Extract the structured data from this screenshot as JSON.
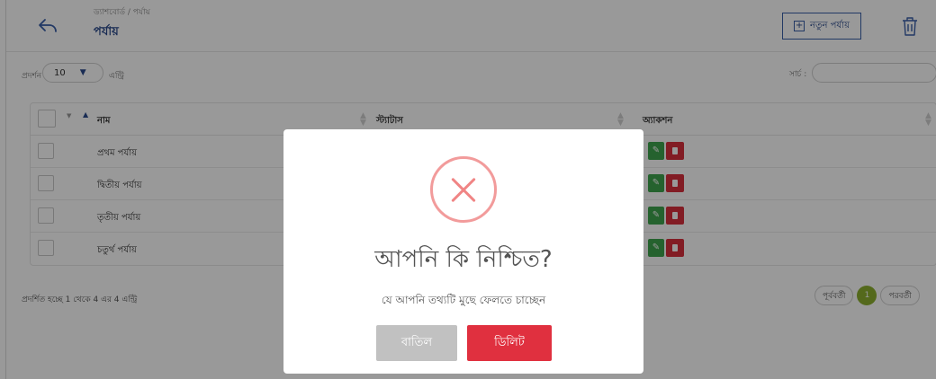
{
  "header": {
    "breadcrumb": "ড্যাশবোর্ড / পর্যায়",
    "title": "পর্যায়",
    "new_button_label": "নতুন পর্যায়",
    "icons": {
      "back": "undo-arrow-icon",
      "trash": "trash-icon",
      "plus": "plus-box-icon"
    }
  },
  "controls": {
    "show_label": "প্রদর্শন",
    "page_size": "10",
    "entries_label": "এন্ট্রি",
    "search_label": "সার্চ :",
    "search_value": ""
  },
  "table": {
    "columns": [
      "নাম",
      "স্ট্যাটাস",
      "অ্যাকশন"
    ],
    "rows": [
      {
        "name": "প্রথম পর্যায়"
      },
      {
        "name": "দ্বিতীয় পর্যায়"
      },
      {
        "name": "তৃতীয় পর্যায়"
      },
      {
        "name": "চতুর্থ পর্যায়"
      }
    ]
  },
  "footer": {
    "info": "প্রদর্শিত হচ্ছে 1 থেকে 4 এর 4 এন্ট্রি",
    "prev": "পূর্ববর্তী",
    "current_page": "1",
    "next": "পরবর্তী"
  },
  "modal": {
    "title": "আপনি কি নিশ্চিত?",
    "text": "যে আপনি তথ্যটি মুছে ফেলতে চাচ্ছেন",
    "cancel_label": "বাতিল",
    "delete_label": "ডিলিট",
    "icon": "x-circle-icon"
  },
  "colors": {
    "brand": "#2b4a8c",
    "delete": "#e0303f",
    "edit": "#3fa34d",
    "pager_active": "#8cb030"
  }
}
